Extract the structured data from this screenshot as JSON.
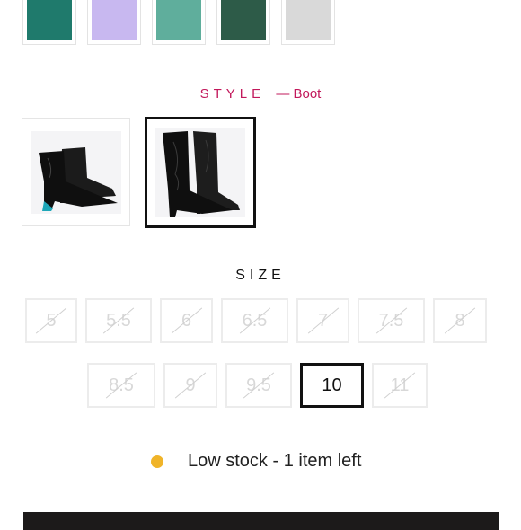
{
  "swatches": [
    {
      "name": "teal-swatch",
      "color": "#1f7a6c"
    },
    {
      "name": "lavender-swatch",
      "color": "#c8b8f0"
    },
    {
      "name": "seafoam-swatch",
      "color": "#5fae9c"
    },
    {
      "name": "forest-swatch",
      "color": "#2d5b48"
    },
    {
      "name": "silver-swatch",
      "color": "#d9d9d9"
    }
  ],
  "style": {
    "label": "STYLE",
    "value": "— Boot",
    "accent_color": "#c2185b",
    "options": [
      {
        "name": "bootie",
        "icon": "short-boot-icon",
        "selected": false
      },
      {
        "name": "boot",
        "icon": "tall-boot-icon",
        "selected": true
      }
    ]
  },
  "size": {
    "label": "SIZE",
    "row1": [
      {
        "label": "5",
        "available": false
      },
      {
        "label": "5.5",
        "available": false
      },
      {
        "label": "6",
        "available": false
      },
      {
        "label": "6.5",
        "available": false
      },
      {
        "label": "7",
        "available": false
      },
      {
        "label": "7.5",
        "available": false
      },
      {
        "label": "8",
        "available": false
      }
    ],
    "row2": [
      {
        "label": "8.5",
        "available": false
      },
      {
        "label": "9",
        "available": false
      },
      {
        "label": "9.5",
        "available": false
      },
      {
        "label": "10",
        "available": true,
        "selected": true
      },
      {
        "label": "11",
        "available": false
      }
    ]
  },
  "stock": {
    "text": "Low stock - 1 item left",
    "dot_color": "#f0b429"
  },
  "colors": {
    "cart_bar": "#1c1a1a",
    "selected_border": "#111111"
  }
}
